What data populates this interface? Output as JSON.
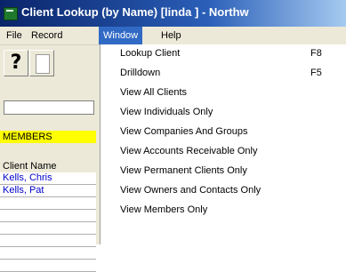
{
  "window": {
    "title": "Client Lookup (by Name) [linda   ] - Northw"
  },
  "menubar": {
    "items": [
      {
        "label": "File"
      },
      {
        "label": "Record"
      },
      {
        "label": "Window"
      },
      {
        "label": "Help"
      }
    ]
  },
  "toolbar": {
    "help_label": "?"
  },
  "left": {
    "filter_badge": "MEMBERS",
    "column_header": "Client Name",
    "rows": [
      "Kells, Chris",
      "Kells, Pat"
    ]
  },
  "window_menu": {
    "items": [
      {
        "label": "Lookup Client",
        "shortcut": "F8"
      },
      {
        "label": "Drilldown",
        "shortcut": "F5"
      },
      {
        "label": "View All Clients"
      },
      {
        "label": "View Individuals Only"
      },
      {
        "label": "View Companies And Groups"
      },
      {
        "label": "View Accounts Receivable Only"
      },
      {
        "label": "View Permanent Clients Only"
      },
      {
        "label": "View Owners and Contacts Only"
      },
      {
        "label": "View Members Only"
      }
    ]
  }
}
